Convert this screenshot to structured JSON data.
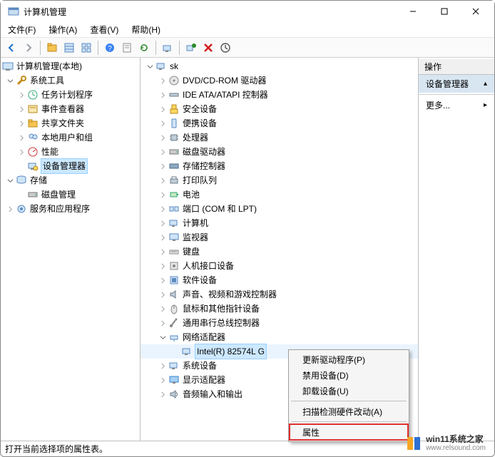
{
  "window": {
    "title": "计算机管理"
  },
  "menu": {
    "file": "文件(F)",
    "action": "操作(A)",
    "view": "查看(V)",
    "help": "帮助(H)"
  },
  "left_tree": {
    "root": "计算机管理(本地)",
    "system_tools": "系统工具",
    "task_scheduler": "任务计划程序",
    "event_viewer": "事件查看器",
    "shared_folders": "共享文件夹",
    "local_users": "本地用户和组",
    "performance": "性能",
    "device_manager": "设备管理器",
    "storage": "存储",
    "disk_mgmt": "磁盘管理",
    "services_apps": "服务和应用程序"
  },
  "mid_tree": {
    "root": "sk",
    "dvd": "DVD/CD-ROM 驱动器",
    "ide": "IDE ATA/ATAPI 控制器",
    "security": "安全设备",
    "portable": "便携设备",
    "cpu": "处理器",
    "disk_drives": "磁盘驱动器",
    "storage_ctrl": "存储控制器",
    "print_queue": "打印队列",
    "battery": "电池",
    "ports": "端口 (COM 和 LPT)",
    "computer": "计算机",
    "monitor": "监视器",
    "keyboard": "键盘",
    "hid": "人机接口设备",
    "software": "软件设备",
    "sound_game": "声音、视频和游戏控制器",
    "mouse": "鼠标和其他指针设备",
    "usb": "通用串行总线控制器",
    "network": "网络适配器",
    "nic_intel": "Intel(R) 82574L G",
    "system_dev": "系统设备",
    "display": "显示适配器",
    "audio_io": "音频输入和输出"
  },
  "right_pane": {
    "header": "操作",
    "device_manager": "设备管理器",
    "more": "更多..."
  },
  "context_menu": {
    "update_driver": "更新驱动程序(P)",
    "disable": "禁用设备(D)",
    "uninstall": "卸载设备(U)",
    "scan_hw": "扫描检测硬件改动(A)",
    "properties": "属性"
  },
  "status": "打开当前选择项的属性表。",
  "watermark": {
    "text": "win11系统之家",
    "url": "www.relsound.com"
  }
}
